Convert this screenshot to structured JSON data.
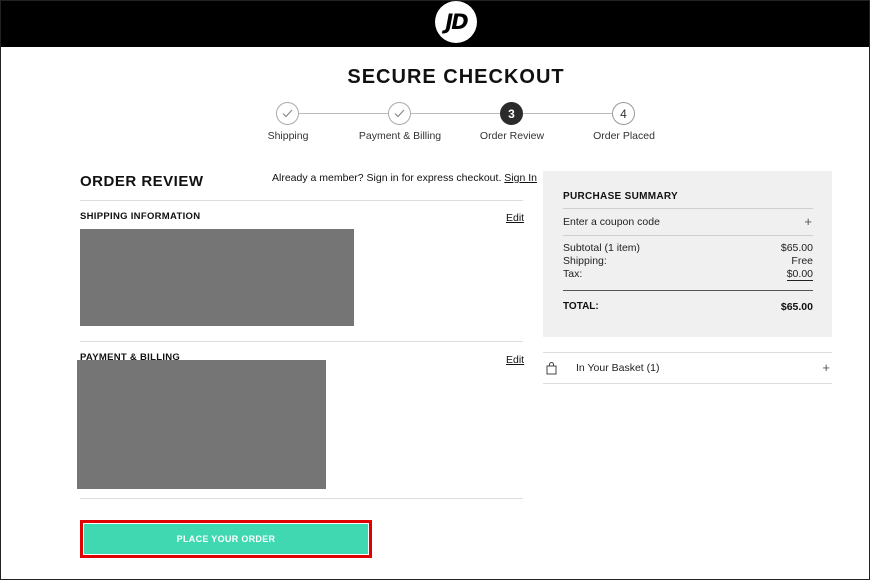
{
  "header": {
    "logo_text": "JD"
  },
  "page": {
    "title": "SECURE CHECKOUT"
  },
  "steps": [
    {
      "label": "Shipping",
      "state": "done",
      "marker": ""
    },
    {
      "label": "Payment & Billing",
      "state": "done",
      "marker": ""
    },
    {
      "label": "Order Review",
      "state": "active",
      "marker": "3"
    },
    {
      "label": "Order Placed",
      "state": "upcoming",
      "marker": "4"
    }
  ],
  "review": {
    "title": "ORDER REVIEW",
    "member_prompt": "Already a member? Sign in for express checkout.",
    "sign_in_label": "Sign In",
    "shipping_heading": "SHIPPING INFORMATION",
    "payment_heading": "PAYMENT & BILLING",
    "edit_label": "Edit",
    "place_order_label": "PLACE YOUR ORDER"
  },
  "summary": {
    "title": "PURCHASE SUMMARY",
    "coupon_label": "Enter a coupon code",
    "subtotal_label": "Subtotal (1 item)",
    "subtotal_value": "$65.00",
    "shipping_label": "Shipping:",
    "shipping_value": "Free",
    "tax_label": "Tax:",
    "tax_value": "$0.00",
    "total_label": "TOTAL:",
    "total_value": "$65.00"
  },
  "basket": {
    "label": "In Your Basket (1)"
  },
  "colors": {
    "accent": "#3fd8b0",
    "highlight": "#e00000",
    "redaction": "#757575"
  },
  "icons": {
    "check": "check-icon",
    "plus": "plus-icon",
    "bag": "shopping-bag-icon"
  }
}
